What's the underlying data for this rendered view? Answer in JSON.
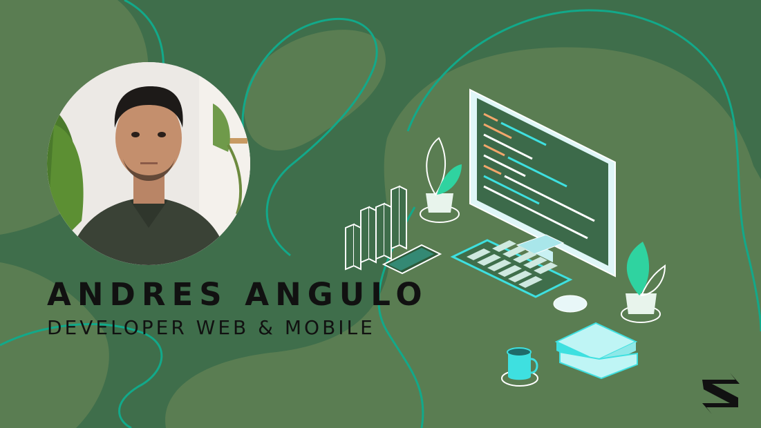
{
  "profile": {
    "name": "ANDRES ANGULO",
    "title": "DEVELOPER WEB & MOBILE"
  },
  "colors": {
    "background": "#3f6e4b",
    "blob": "#5a7d52",
    "accent_line": "#12a98a",
    "illustration_cyan": "#3ee0e0",
    "text": "#111111"
  },
  "icons": [
    "avatar-photo",
    "bar-chart-icon",
    "smartphone-icon",
    "monitor-icon",
    "keyboard-icon",
    "mouse-icon",
    "plant-icon",
    "coffee-mug-icon",
    "books-icon",
    "brand-logo"
  ]
}
